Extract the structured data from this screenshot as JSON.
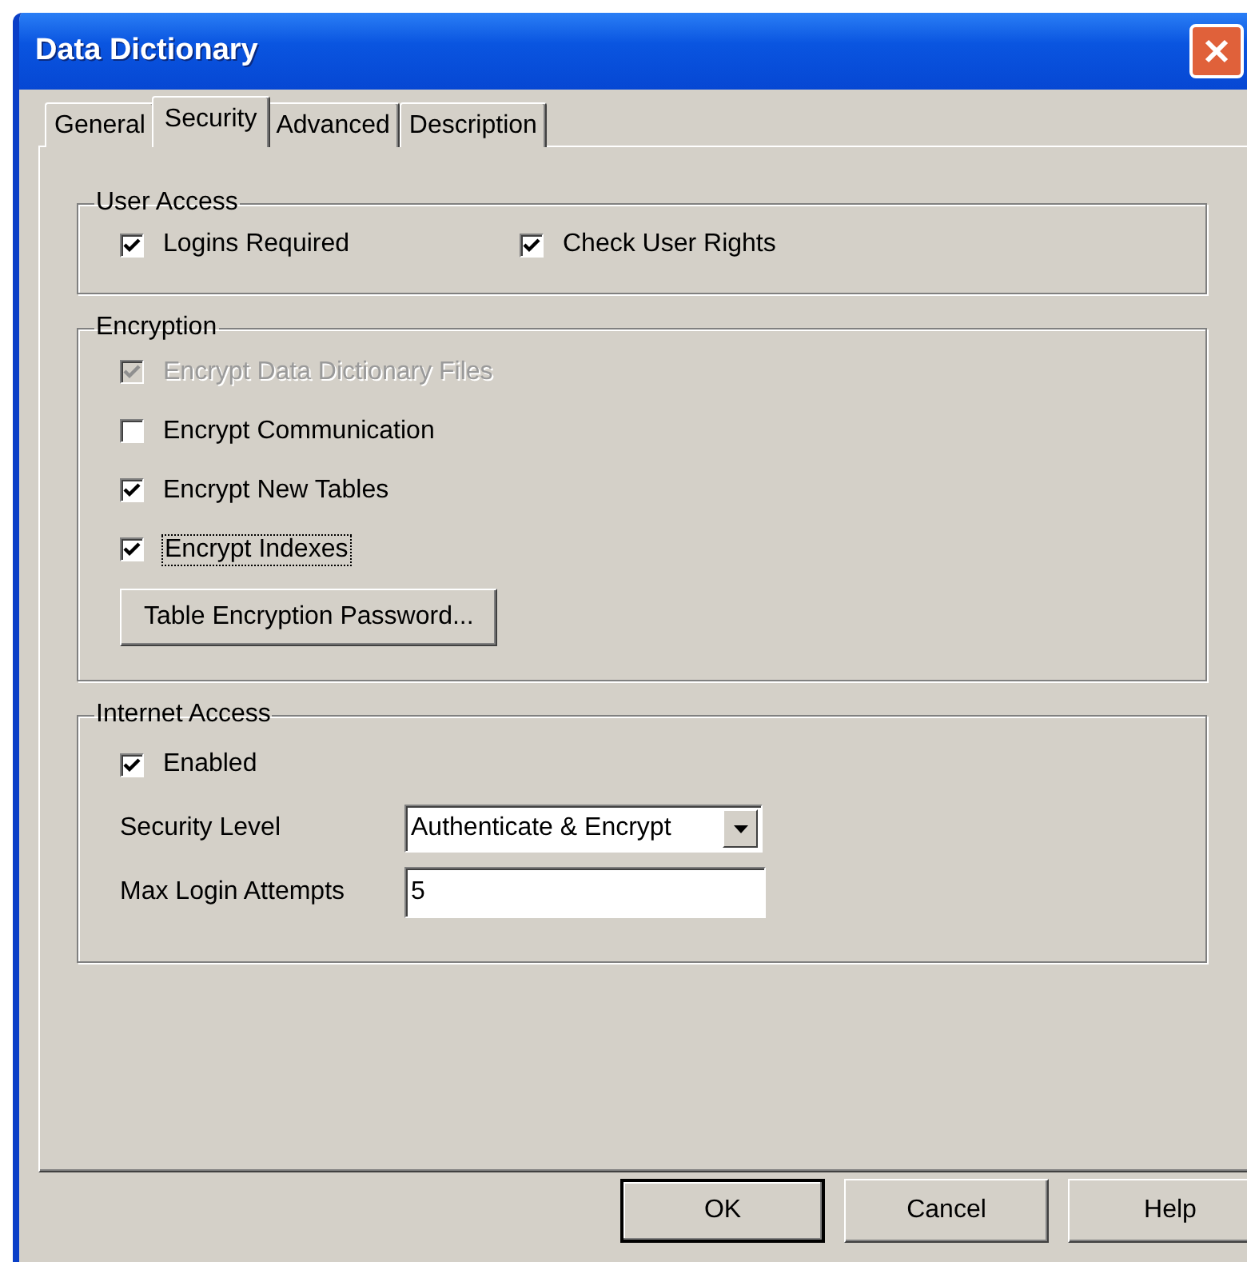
{
  "window": {
    "title": "Data Dictionary"
  },
  "tabs": [
    {
      "label": "General",
      "selected": false
    },
    {
      "label": "Security",
      "selected": true
    },
    {
      "label": "Advanced",
      "selected": false
    },
    {
      "label": "Description",
      "selected": false
    }
  ],
  "user_access": {
    "title": "User Access",
    "options": [
      {
        "label": "Logins Required",
        "checked": true
      },
      {
        "label": "Check User Rights",
        "checked": true
      }
    ]
  },
  "encryption": {
    "title": "Encryption",
    "options": [
      {
        "label": "Encrypt Data Dictionary Files",
        "checked": true,
        "disabled": true,
        "focused": false
      },
      {
        "label": "Encrypt Communication",
        "checked": false,
        "disabled": false,
        "focused": false
      },
      {
        "label": "Encrypt New Tables",
        "checked": true,
        "disabled": false,
        "focused": false
      },
      {
        "label": "Encrypt Indexes",
        "checked": true,
        "disabled": false,
        "focused": true
      }
    ],
    "button": "Table Encryption Password..."
  },
  "internet_access": {
    "title": "Internet Access",
    "rows": [
      {
        "kind": "checkbox",
        "label": "Enabled",
        "checked": true
      },
      {
        "kind": "dropdown",
        "label": "Security Level",
        "value": "Authenticate & Encrypt"
      },
      {
        "kind": "text",
        "label": "Max Login Attempts",
        "value": "5"
      }
    ]
  },
  "buttons": [
    {
      "label": "OK",
      "default": true
    },
    {
      "label": "Cancel",
      "default": false
    },
    {
      "label": "Help",
      "default": false
    }
  ]
}
